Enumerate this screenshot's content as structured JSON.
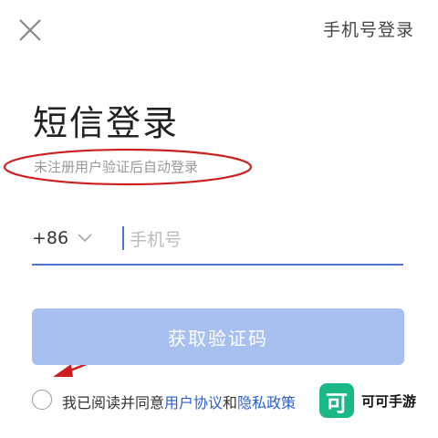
{
  "header": {
    "close_icon": "close-icon",
    "switch_label": "手机号登录"
  },
  "main": {
    "title": "短信登录",
    "subtitle": "未注册用户验证后自动登录",
    "country_code": "+86",
    "phone_placeholder": "手机号",
    "phone_value": "",
    "get_code_label": "获取验证码"
  },
  "agreement": {
    "prefix": "我已阅读并同意",
    "user_agreement": "用户协议",
    "and": "和",
    "privacy_policy": "隐私政策"
  },
  "watermark": {
    "logo_char": "可",
    "text": "可可手游"
  },
  "colors": {
    "accent": "#4a78d0",
    "button_bg": "#a8c0f0",
    "link": "#2c5fcc",
    "annotation": "#cc1f1f",
    "watermark": "#1bb88a"
  }
}
